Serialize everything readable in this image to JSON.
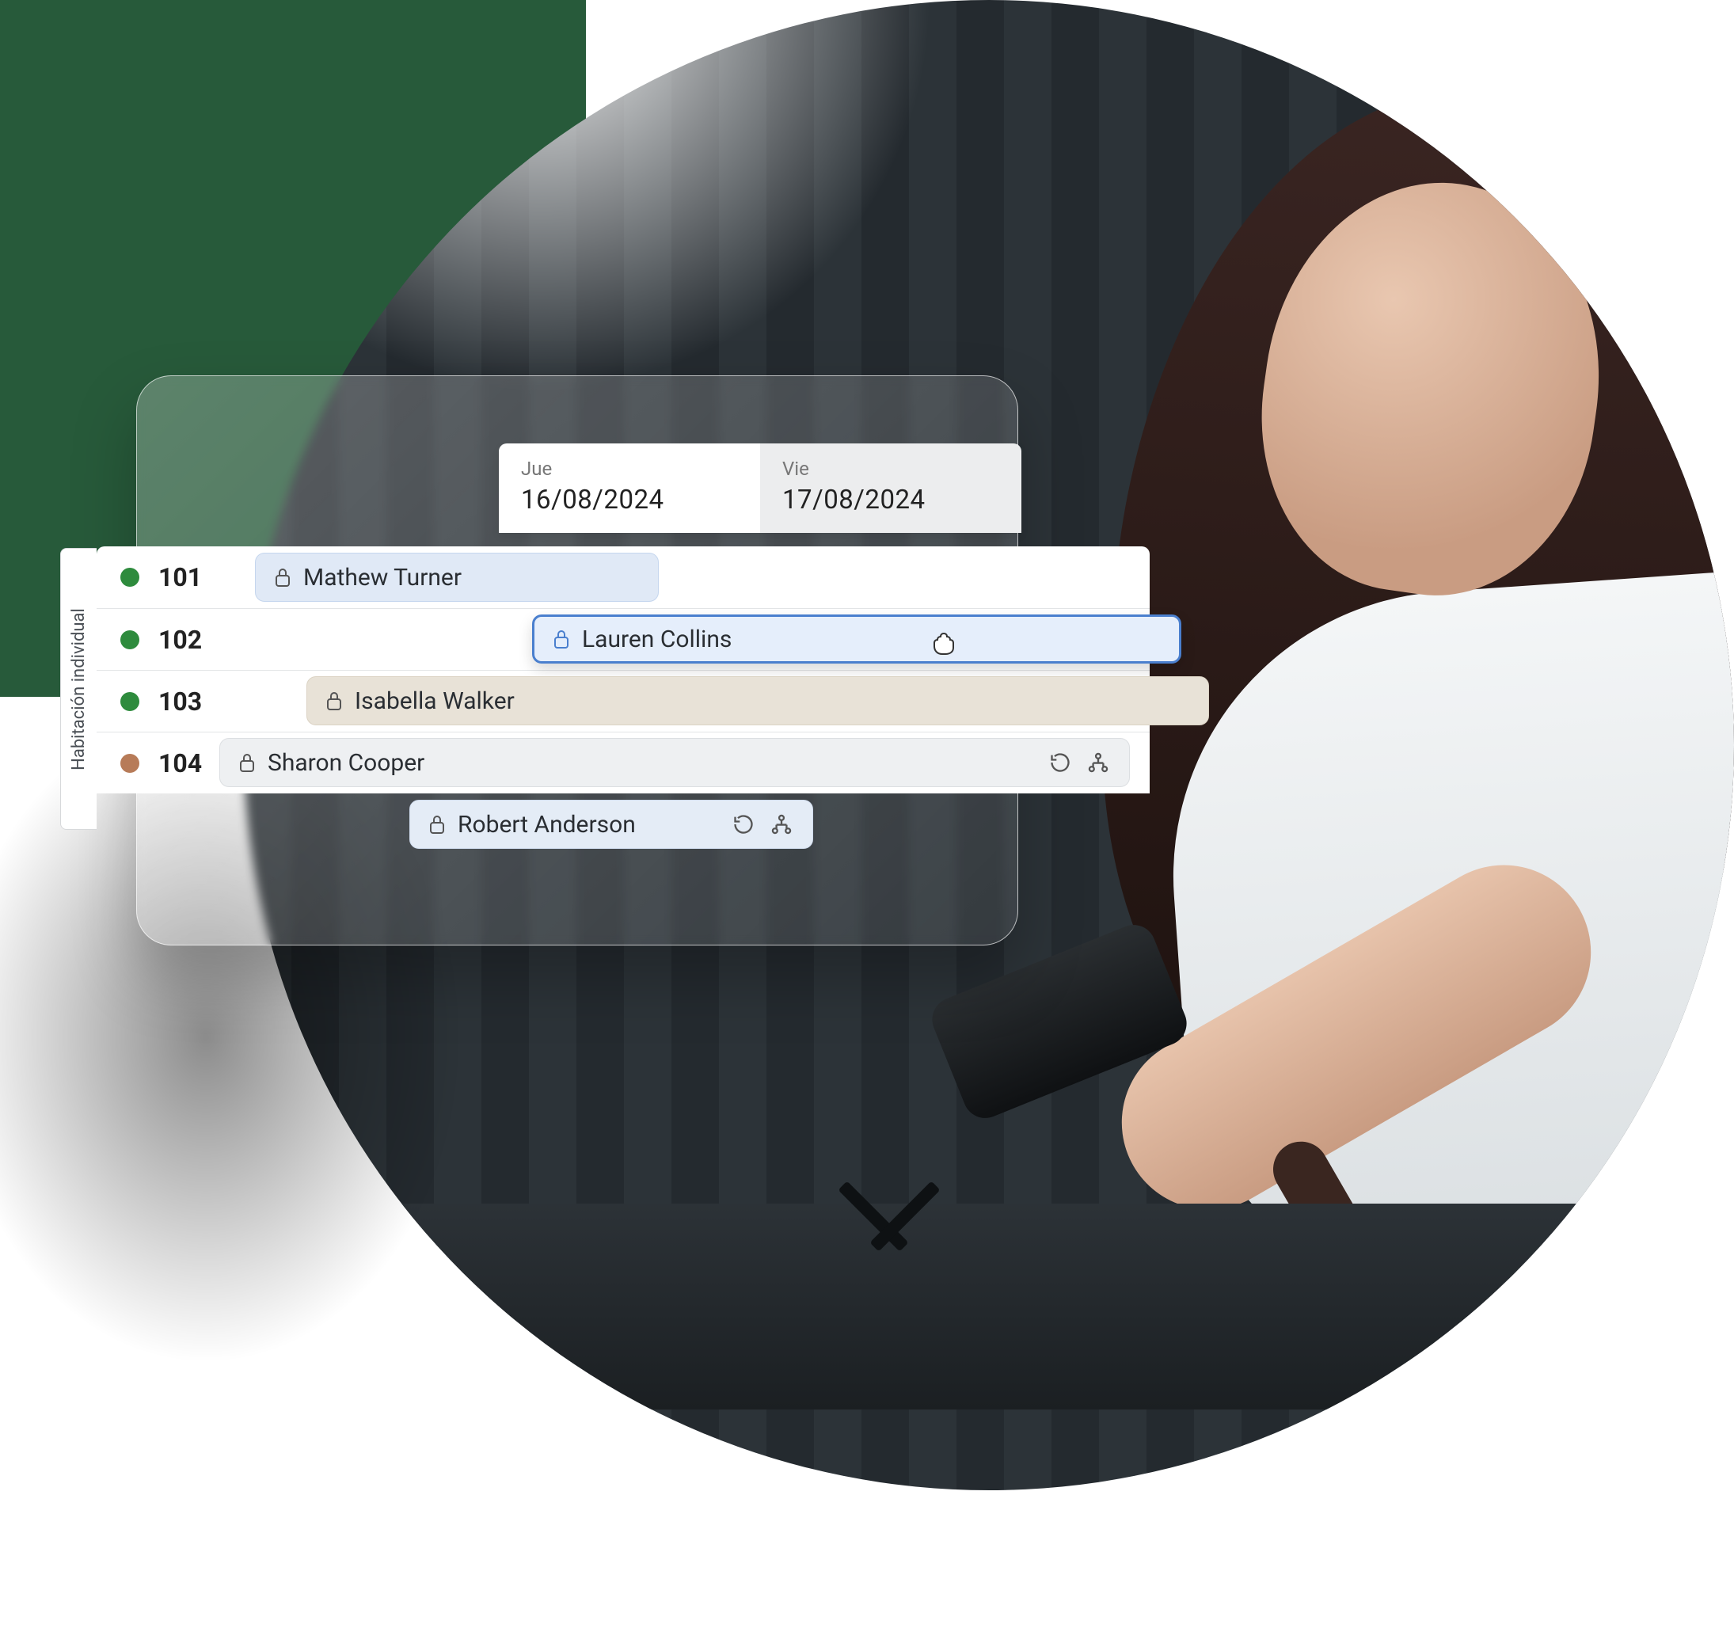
{
  "room_type_label": "Habitación individual",
  "dates": [
    {
      "day": "Jue",
      "value": "16/08/2024"
    },
    {
      "day": "Vie",
      "value": "17/08/2024"
    }
  ],
  "rooms": [
    {
      "number": "101",
      "status_color": "green"
    },
    {
      "number": "102",
      "status_color": "green"
    },
    {
      "number": "103",
      "status_color": "green"
    },
    {
      "number": "104",
      "status_color": "brown"
    }
  ],
  "bookings": [
    {
      "guest": "Mathew Turner",
      "style": "blue"
    },
    {
      "guest": "Lauren Collins",
      "style": "blue-drag",
      "dragging": true
    },
    {
      "guest": "Isabella Walker",
      "style": "tan"
    },
    {
      "guest": "Sharon Cooper",
      "style": "gray",
      "actions": [
        "refresh",
        "share"
      ]
    },
    {
      "guest": "Robert Anderson",
      "style": "lightblue",
      "actions": [
        "refresh",
        "share"
      ]
    }
  ],
  "icons": {
    "lock": "lock",
    "refresh": "refresh",
    "share": "sitemap",
    "cursor": "grab"
  }
}
